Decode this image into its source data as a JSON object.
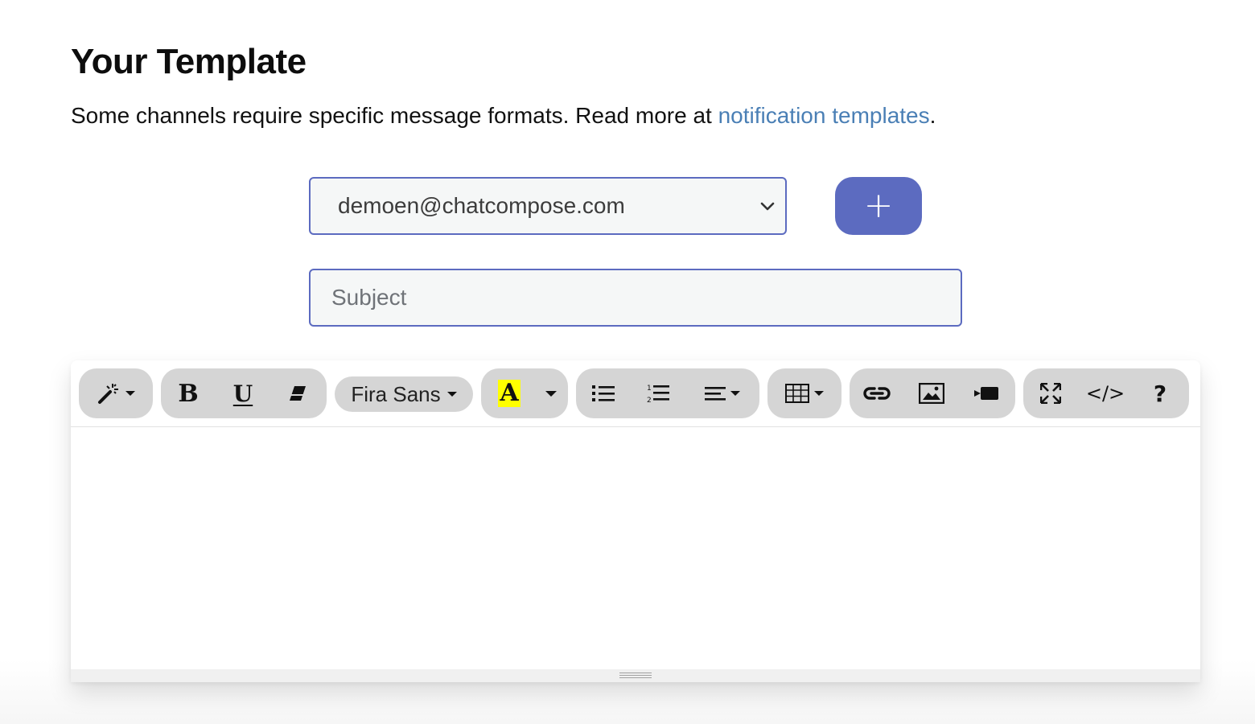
{
  "page": {
    "title": "Your Template",
    "description_prefix": "Some channels require specific message formats. Read more at ",
    "description_link": "notification templates",
    "description_suffix": "."
  },
  "sender_select": {
    "value": "demoen@chatcompose.com"
  },
  "add_button": {
    "label": "+"
  },
  "subject_input": {
    "placeholder": "Subject",
    "value": ""
  },
  "toolbar": {
    "groups": [
      {
        "name": "style",
        "buttons": [
          {
            "icon": "magic-wand-icon",
            "dropdown": true
          }
        ]
      },
      {
        "name": "font",
        "buttons": [
          {
            "icon": "bold-icon",
            "label": "B"
          },
          {
            "icon": "underline-icon",
            "label": "U"
          },
          {
            "icon": "eraser-icon"
          }
        ]
      },
      {
        "name": "fontname",
        "buttons": [
          {
            "label": "Fira Sans",
            "dropdown": true
          }
        ]
      },
      {
        "name": "color",
        "buttons": [
          {
            "icon": "text-color-icon",
            "label": "A"
          },
          {
            "icon": "chevron-down-icon",
            "dropdown": true
          }
        ]
      },
      {
        "name": "paragraph",
        "buttons": [
          {
            "icon": "unordered-list-icon"
          },
          {
            "icon": "ordered-list-icon"
          },
          {
            "icon": "align-icon",
            "dropdown": true
          }
        ]
      },
      {
        "name": "table",
        "buttons": [
          {
            "icon": "table-icon",
            "dropdown": true
          }
        ]
      },
      {
        "name": "insert",
        "buttons": [
          {
            "icon": "link-icon"
          },
          {
            "icon": "image-icon"
          },
          {
            "icon": "video-icon"
          }
        ]
      },
      {
        "name": "view",
        "buttons": [
          {
            "icon": "fullscreen-icon"
          },
          {
            "icon": "code-view-icon",
            "label": "</>"
          },
          {
            "icon": "help-icon",
            "label": "?"
          }
        ]
      }
    ],
    "bold_label": "B",
    "underline_label": "U",
    "font_name": "Fira Sans",
    "text_color_label": "A",
    "code_label": "</>",
    "help_label": "?"
  },
  "colors": {
    "accent": "#5c6bc0",
    "link": "#4a7fb5",
    "highlight": "#ffff00",
    "toolbar_group_bg": "#d5d5d5",
    "input_bg": "#f5f7f7"
  }
}
